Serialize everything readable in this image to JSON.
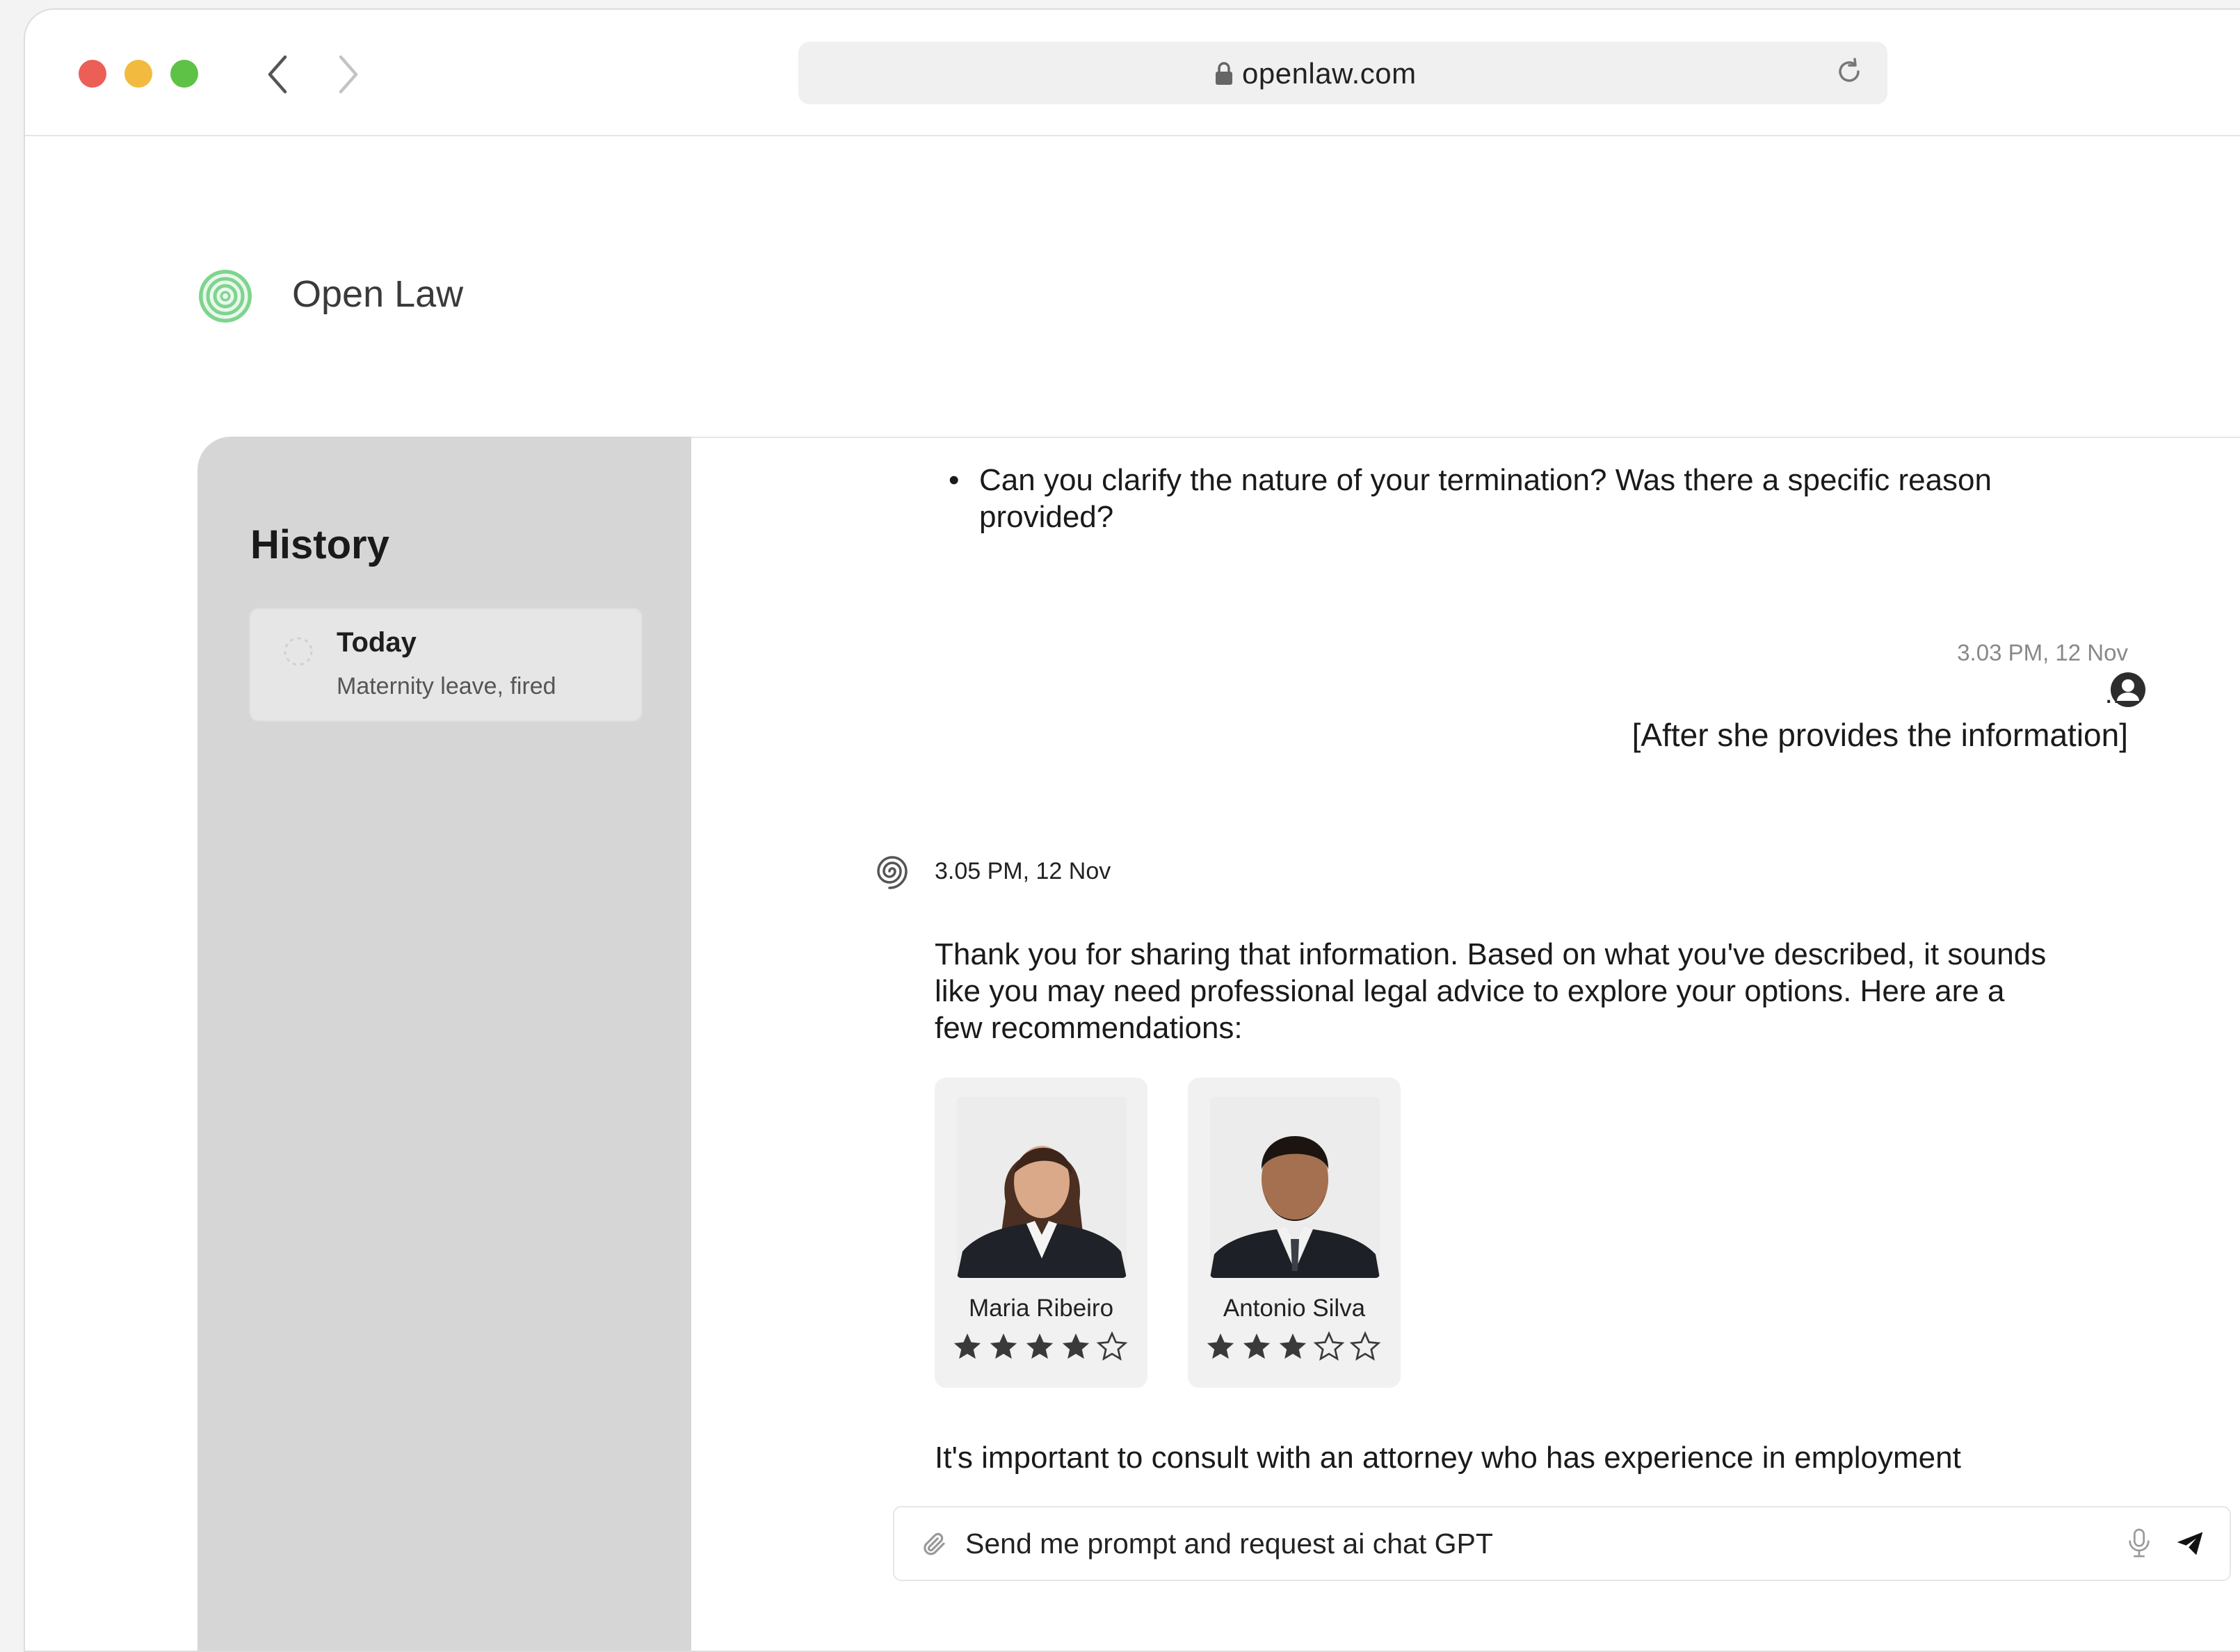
{
  "browser": {
    "url": "openlaw.com"
  },
  "app": {
    "name": "Open Law",
    "brand_color": "#5cc46f"
  },
  "sidebar": {
    "title": "History",
    "items": [
      {
        "day": "Today",
        "subtitle": "Maternity leave, fired"
      }
    ]
  },
  "chat": {
    "bullet": "Can you clarify the nature of your termination? Was there a specific reason provided?",
    "user_timestamp": "3.03 PM, 12 Nov",
    "user_ellipsis": "...",
    "user_message": "[After she provides the information]",
    "bot_timestamp": "3.05 PM, 12 Nov",
    "bot_message": "Thank you for sharing that information. Based on what you've described, it sounds like you may need professional legal advice to explore your options. Here are a few recommendations:",
    "lawyers": [
      {
        "name": "Maria Ribeiro",
        "rating": 4,
        "max_rating": 5
      },
      {
        "name": "Antonio Silva",
        "rating": 3,
        "max_rating": 5
      }
    ],
    "followup_message": "It's important to consult with an attorney who has experience in employment"
  },
  "input": {
    "placeholder": "Send me prompt and request ai chat GPT"
  },
  "icons": {
    "lock": "lock-icon",
    "reload": "reload-icon",
    "back": "chevron-left-icon",
    "forward": "chevron-right-icon",
    "attach": "paperclip-icon",
    "mic": "microphone-icon",
    "send": "send-icon",
    "user": "user-avatar-icon",
    "bot": "spiral-logo-icon"
  }
}
